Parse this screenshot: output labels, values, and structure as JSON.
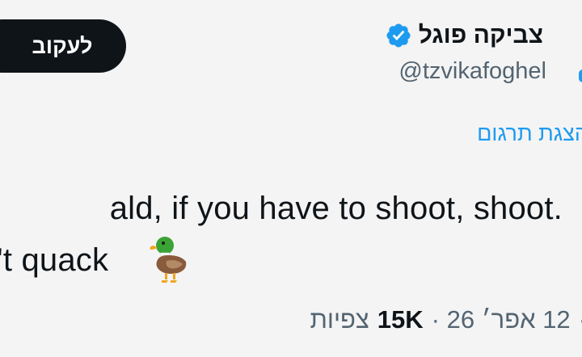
{
  "header": {
    "follow_label": "לעקוב",
    "display_name": "צביקה פוגל",
    "handle": "@tzvikafoghel",
    "verified_icon": "verified-badge-icon",
    "verified_color": "#1d9bf0"
  },
  "translate": {
    "label": "הצגת תרגום"
  },
  "tweet": {
    "line1": "ald, if you have to shoot, shoot.",
    "line2": "'t quack",
    "emoji": "duck-icon"
  },
  "meta": {
    "date_time": "12 אפר׳ 26 ·",
    "views_count": "15K",
    "views_label": "צפיות",
    "leading_text": "·"
  },
  "colors": {
    "background": "#f4f4f4",
    "text": "#0f1419",
    "secondary": "#536471",
    "accent": "#1d9bf0",
    "button": "#0f1419"
  }
}
